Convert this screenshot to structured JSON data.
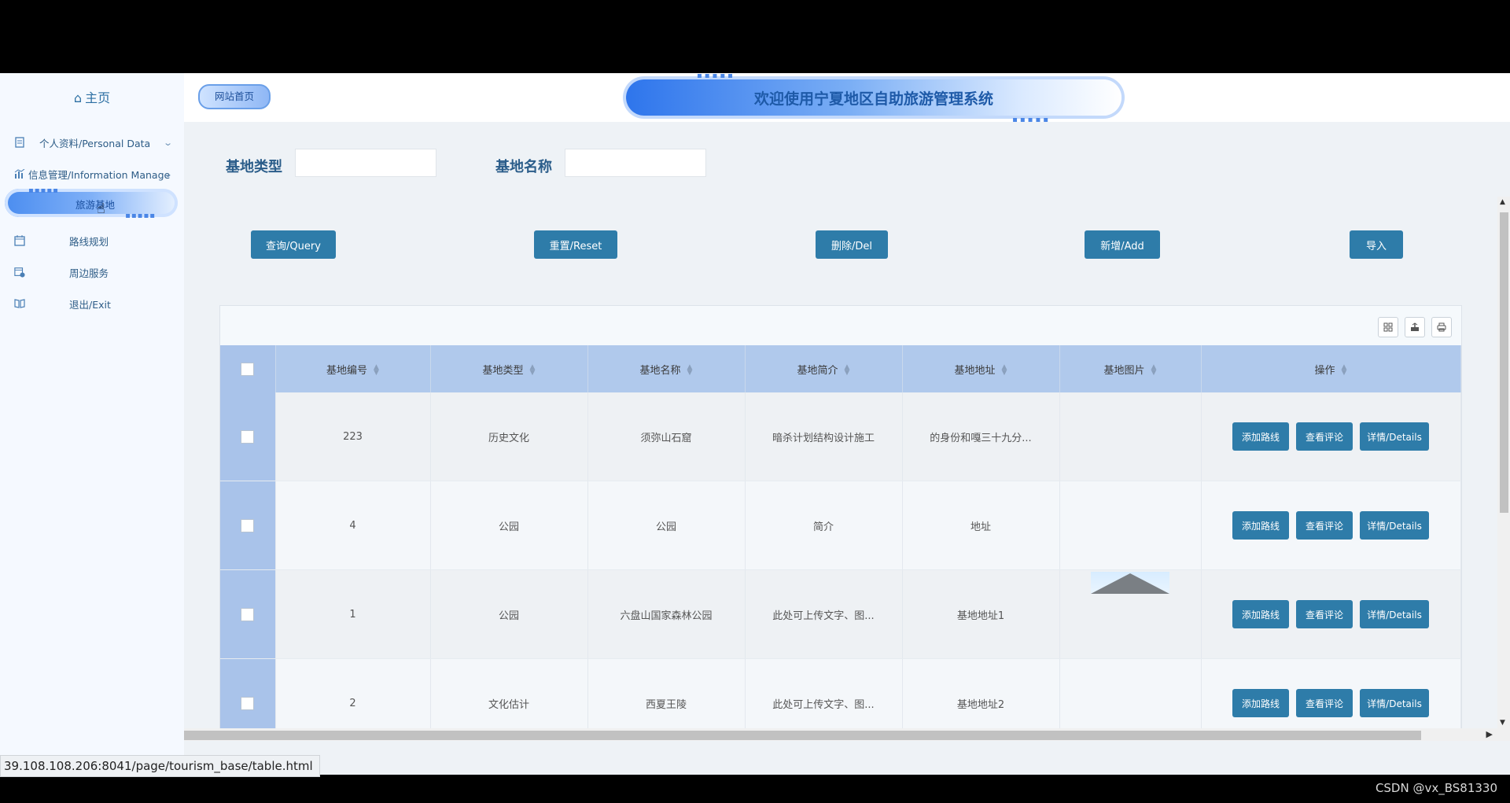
{
  "sidebar": {
    "home_label": "主页",
    "items": [
      {
        "label": "个人资料/Personal Data",
        "icon": "document-icon"
      },
      {
        "label": "信息管理/Information Manage",
        "icon": "chart-icon"
      },
      {
        "label": "旅游基地",
        "icon": ""
      },
      {
        "label": "路线规划",
        "icon": "calendar-icon"
      },
      {
        "label": "周边服务",
        "icon": "calendar-check-icon"
      },
      {
        "label": "退出/Exit",
        "icon": "book-icon"
      }
    ]
  },
  "header": {
    "site_home": "网站首页",
    "title": "欢迎使用宁夏地区自助旅游管理系统"
  },
  "search": {
    "type_label": "基地类型",
    "name_label": "基地名称"
  },
  "buttons": {
    "query": "查询/Query",
    "reset": "重置/Reset",
    "delete": "删除/Del",
    "add": "新增/Add",
    "import": "导入"
  },
  "table": {
    "columns": [
      "基地编号",
      "基地类型",
      "基地名称",
      "基地简介",
      "基地地址",
      "基地图片",
      "操作"
    ],
    "rows": [
      {
        "id": "223",
        "type": "历史文化",
        "name": "须弥山石窟",
        "intro": "暗杀计划结构设计施工",
        "address": "的身份和嘎三十九分...",
        "has_image": false
      },
      {
        "id": "4",
        "type": "公园",
        "name": "公园",
        "intro": "简介",
        "address": "地址",
        "has_image": false
      },
      {
        "id": "1",
        "type": "公园",
        "name": "六盘山国家森林公园",
        "intro": "此处可上传文字、图...",
        "address": "基地地址1",
        "has_image": true
      },
      {
        "id": "2",
        "type": "文化估计",
        "name": "西夏王陵",
        "intro": "此处可上传文字、图...",
        "address": "基地地址2",
        "has_image": false
      }
    ],
    "ops": {
      "add_route": "添加路线",
      "view_comments": "查看评论",
      "details": "详情/Details"
    }
  },
  "statusbar": {
    "url": "39.108.108.206:8041/page/tourism_base/table.html"
  },
  "watermark": "CSDN @vx_BS81330",
  "colors": {
    "primary_button": "#2e7ca9",
    "header_row": "#b0c9ec",
    "sidebar_text": "#2d5c86"
  }
}
